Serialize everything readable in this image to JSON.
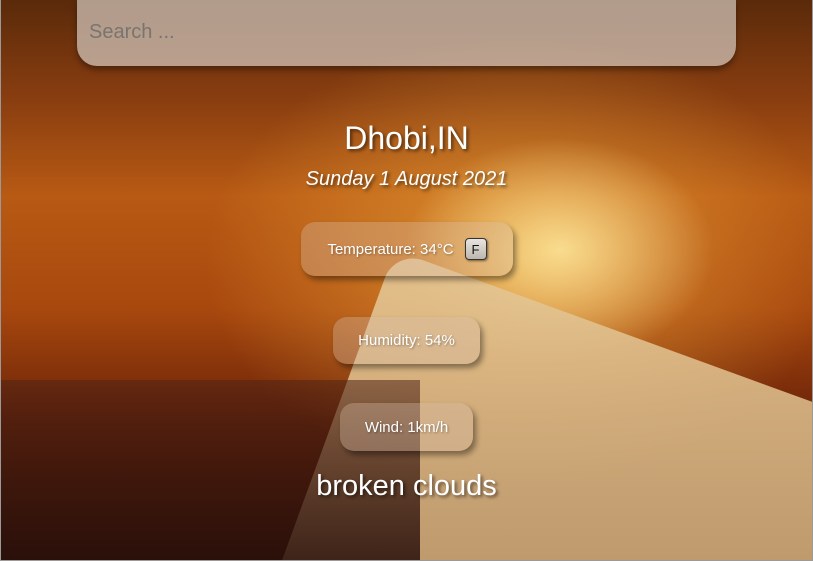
{
  "search": {
    "placeholder": "Search ..."
  },
  "weather": {
    "city": "Dhobi,IN",
    "date": "Sunday 1 August 2021",
    "temperature_label": "Temperature: 34°C",
    "unit_toggle": "F",
    "humidity_label": "Humidity: 54%",
    "wind_label": "Wind: 1km/h",
    "description": "broken clouds"
  }
}
